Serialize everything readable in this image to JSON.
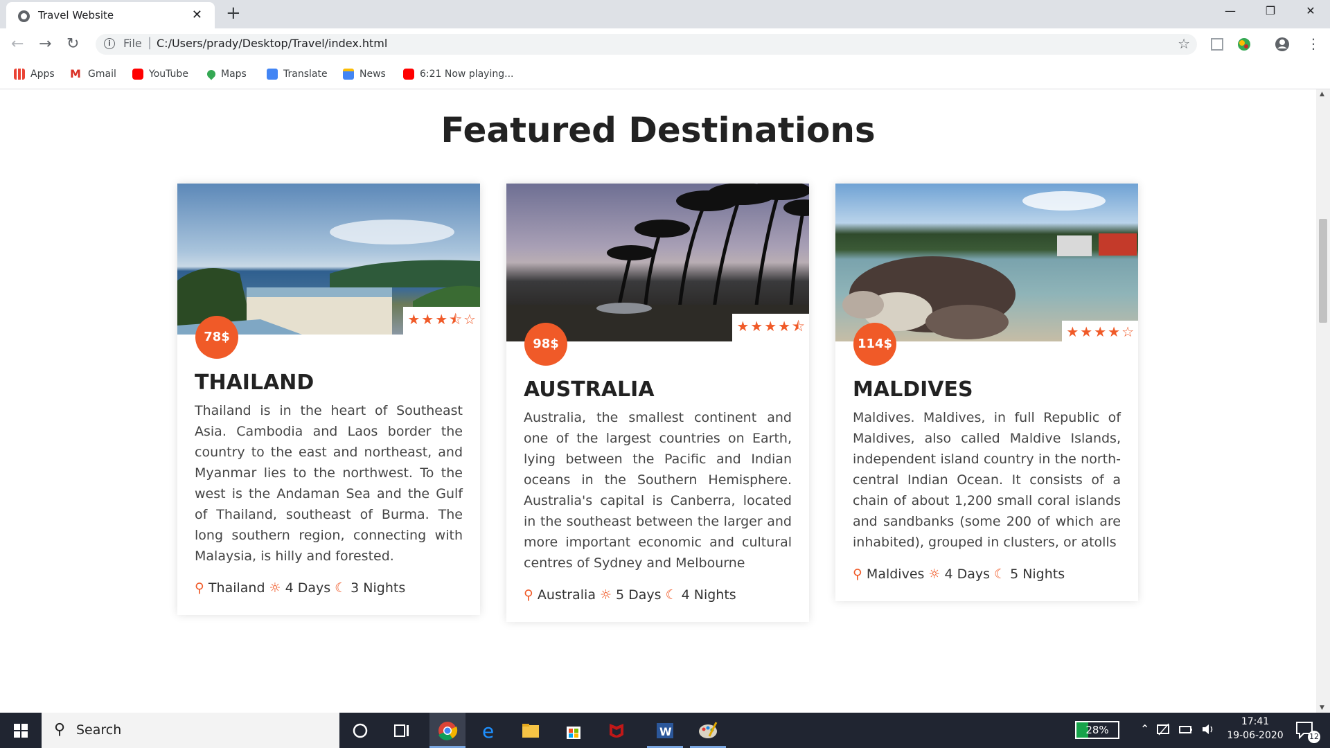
{
  "browser": {
    "tab_title": "Travel Website",
    "close_tab": "✕",
    "new_tab": "+",
    "address_scheme": "File",
    "address_url": "C:/Users/prady/Desktop/Travel/index.html",
    "bookmarks": [
      {
        "label": "Apps",
        "icon": "apps-icon",
        "color": "#4285f4"
      },
      {
        "label": "Gmail",
        "icon": "gmail-icon",
        "color": "#d93025"
      },
      {
        "label": "YouTube",
        "icon": "youtube-icon",
        "color": "#ff0000"
      },
      {
        "label": "Maps",
        "icon": "maps-icon",
        "color": "#34a853"
      },
      {
        "label": "Translate",
        "icon": "translate-icon",
        "color": "#4285f4"
      },
      {
        "label": "News",
        "icon": "news-icon",
        "color": "#4285f4"
      },
      {
        "label": "6:21 Now playing...",
        "icon": "youtube-icon",
        "color": "#ff0000"
      }
    ]
  },
  "page": {
    "heading": "Featured Destinations",
    "accent_color": "#f05a28",
    "cards": [
      {
        "name": "THAILAND",
        "price": "78$",
        "rating": 3.5,
        "stars": "★★★⯪☆",
        "description": "Thailand is in the heart of Southeast Asia. Cambodia and Laos border the country to the east and northeast, and Myanmar lies to the northwest. To the west is the Andaman Sea and the Gulf of Thailand, southeast of Burma. The long southern region, connecting with Malaysia, is hilly and forested.",
        "location": "Thailand",
        "days": "4 Days",
        "nights": "3 Nights"
      },
      {
        "name": "AUSTRALIA",
        "price": "98$",
        "rating": 4.5,
        "stars": "★★★★⯪",
        "description": "Australia, the smallest continent and one of the largest countries on Earth, lying between the Pacific and Indian oceans in the Southern Hemisphere. Australia's capital is Canberra, located in the southeast between the larger and more important economic and cultural centres of Sydney and Melbourne",
        "location": "Australia",
        "days": "5 Days",
        "nights": "4 Nights"
      },
      {
        "name": "MALDIVES",
        "price": "114$",
        "rating": 4,
        "stars": "★★★★☆",
        "description": "Maldives. Maldives, in full Republic of Maldives, also called Maldive Islands, independent island country in the north-central Indian Ocean. It consists of a chain of about 1,200 small coral islands and sandbanks (some 200 of which are inhabited), grouped in clusters, or atolls",
        "location": "Maldives",
        "days": "4 Days",
        "nights": "5 Nights"
      }
    ]
  },
  "taskbar": {
    "search_placeholder": "Search",
    "battery": "28%",
    "time": "17:41",
    "date": "19-06-2020",
    "notification_count": "12"
  }
}
